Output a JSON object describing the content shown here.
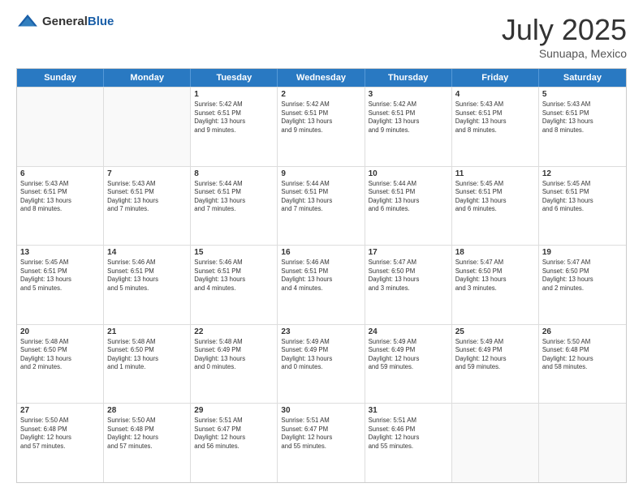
{
  "header": {
    "logo_general": "General",
    "logo_blue": "Blue",
    "month": "July 2025",
    "location": "Sunuapa, Mexico"
  },
  "weekdays": [
    "Sunday",
    "Monday",
    "Tuesday",
    "Wednesday",
    "Thursday",
    "Friday",
    "Saturday"
  ],
  "rows": [
    [
      {
        "day": "",
        "info": ""
      },
      {
        "day": "",
        "info": ""
      },
      {
        "day": "1",
        "info": "Sunrise: 5:42 AM\nSunset: 6:51 PM\nDaylight: 13 hours\nand 9 minutes."
      },
      {
        "day": "2",
        "info": "Sunrise: 5:42 AM\nSunset: 6:51 PM\nDaylight: 13 hours\nand 9 minutes."
      },
      {
        "day": "3",
        "info": "Sunrise: 5:42 AM\nSunset: 6:51 PM\nDaylight: 13 hours\nand 9 minutes."
      },
      {
        "day": "4",
        "info": "Sunrise: 5:43 AM\nSunset: 6:51 PM\nDaylight: 13 hours\nand 8 minutes."
      },
      {
        "day": "5",
        "info": "Sunrise: 5:43 AM\nSunset: 6:51 PM\nDaylight: 13 hours\nand 8 minutes."
      }
    ],
    [
      {
        "day": "6",
        "info": "Sunrise: 5:43 AM\nSunset: 6:51 PM\nDaylight: 13 hours\nand 8 minutes."
      },
      {
        "day": "7",
        "info": "Sunrise: 5:43 AM\nSunset: 6:51 PM\nDaylight: 13 hours\nand 7 minutes."
      },
      {
        "day": "8",
        "info": "Sunrise: 5:44 AM\nSunset: 6:51 PM\nDaylight: 13 hours\nand 7 minutes."
      },
      {
        "day": "9",
        "info": "Sunrise: 5:44 AM\nSunset: 6:51 PM\nDaylight: 13 hours\nand 7 minutes."
      },
      {
        "day": "10",
        "info": "Sunrise: 5:44 AM\nSunset: 6:51 PM\nDaylight: 13 hours\nand 6 minutes."
      },
      {
        "day": "11",
        "info": "Sunrise: 5:45 AM\nSunset: 6:51 PM\nDaylight: 13 hours\nand 6 minutes."
      },
      {
        "day": "12",
        "info": "Sunrise: 5:45 AM\nSunset: 6:51 PM\nDaylight: 13 hours\nand 6 minutes."
      }
    ],
    [
      {
        "day": "13",
        "info": "Sunrise: 5:45 AM\nSunset: 6:51 PM\nDaylight: 13 hours\nand 5 minutes."
      },
      {
        "day": "14",
        "info": "Sunrise: 5:46 AM\nSunset: 6:51 PM\nDaylight: 13 hours\nand 5 minutes."
      },
      {
        "day": "15",
        "info": "Sunrise: 5:46 AM\nSunset: 6:51 PM\nDaylight: 13 hours\nand 4 minutes."
      },
      {
        "day": "16",
        "info": "Sunrise: 5:46 AM\nSunset: 6:51 PM\nDaylight: 13 hours\nand 4 minutes."
      },
      {
        "day": "17",
        "info": "Sunrise: 5:47 AM\nSunset: 6:50 PM\nDaylight: 13 hours\nand 3 minutes."
      },
      {
        "day": "18",
        "info": "Sunrise: 5:47 AM\nSunset: 6:50 PM\nDaylight: 13 hours\nand 3 minutes."
      },
      {
        "day": "19",
        "info": "Sunrise: 5:47 AM\nSunset: 6:50 PM\nDaylight: 13 hours\nand 2 minutes."
      }
    ],
    [
      {
        "day": "20",
        "info": "Sunrise: 5:48 AM\nSunset: 6:50 PM\nDaylight: 13 hours\nand 2 minutes."
      },
      {
        "day": "21",
        "info": "Sunrise: 5:48 AM\nSunset: 6:50 PM\nDaylight: 13 hours\nand 1 minute."
      },
      {
        "day": "22",
        "info": "Sunrise: 5:48 AM\nSunset: 6:49 PM\nDaylight: 13 hours\nand 0 minutes."
      },
      {
        "day": "23",
        "info": "Sunrise: 5:49 AM\nSunset: 6:49 PM\nDaylight: 13 hours\nand 0 minutes."
      },
      {
        "day": "24",
        "info": "Sunrise: 5:49 AM\nSunset: 6:49 PM\nDaylight: 12 hours\nand 59 minutes."
      },
      {
        "day": "25",
        "info": "Sunrise: 5:49 AM\nSunset: 6:49 PM\nDaylight: 12 hours\nand 59 minutes."
      },
      {
        "day": "26",
        "info": "Sunrise: 5:50 AM\nSunset: 6:48 PM\nDaylight: 12 hours\nand 58 minutes."
      }
    ],
    [
      {
        "day": "27",
        "info": "Sunrise: 5:50 AM\nSunset: 6:48 PM\nDaylight: 12 hours\nand 57 minutes."
      },
      {
        "day": "28",
        "info": "Sunrise: 5:50 AM\nSunset: 6:48 PM\nDaylight: 12 hours\nand 57 minutes."
      },
      {
        "day": "29",
        "info": "Sunrise: 5:51 AM\nSunset: 6:47 PM\nDaylight: 12 hours\nand 56 minutes."
      },
      {
        "day": "30",
        "info": "Sunrise: 5:51 AM\nSunset: 6:47 PM\nDaylight: 12 hours\nand 55 minutes."
      },
      {
        "day": "31",
        "info": "Sunrise: 5:51 AM\nSunset: 6:46 PM\nDaylight: 12 hours\nand 55 minutes."
      },
      {
        "day": "",
        "info": ""
      },
      {
        "day": "",
        "info": ""
      }
    ]
  ]
}
